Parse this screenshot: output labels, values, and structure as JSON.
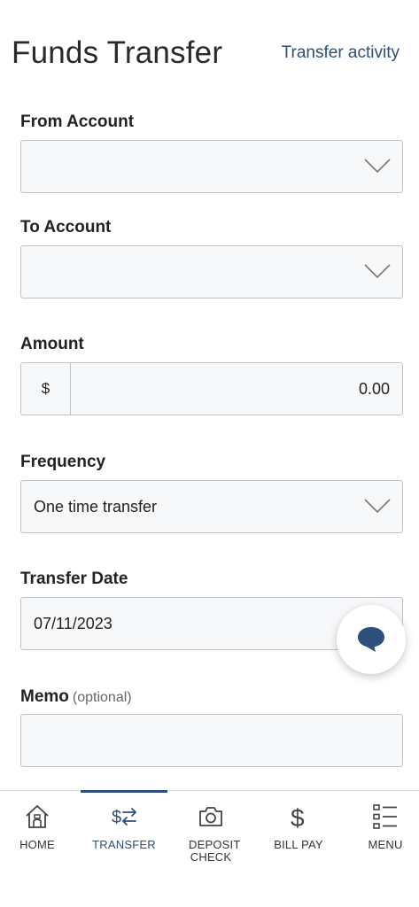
{
  "header": {
    "title": "Funds Transfer",
    "activity_link": "Transfer activity"
  },
  "form": {
    "from_account": {
      "label": "From Account",
      "value": ""
    },
    "to_account": {
      "label": "To Account",
      "value": ""
    },
    "amount": {
      "label": "Amount",
      "currency": "$",
      "value": "0.00"
    },
    "frequency": {
      "label": "Frequency",
      "value": "One time transfer"
    },
    "transfer_date": {
      "label": "Transfer Date",
      "value": "07/11/2023"
    },
    "memo": {
      "label": "Memo",
      "optional": "(optional)",
      "value": ""
    }
  },
  "chat": {
    "icon": "chat-bubble-icon"
  },
  "nav": {
    "items": [
      {
        "label": "HOME",
        "icon": "home-icon"
      },
      {
        "label": "TRANSFER",
        "icon": "transfer-icon",
        "active": true
      },
      {
        "label": "DEPOSIT CHECK",
        "icon": "camera-icon"
      },
      {
        "label": "BILL PAY",
        "icon": "dollar-icon"
      },
      {
        "label": "MENU",
        "icon": "menu-list-icon"
      }
    ]
  },
  "colors": {
    "accent": "#2c4f7c",
    "field_bg": "#f7f8fa",
    "field_border": "#bfc3c8"
  }
}
